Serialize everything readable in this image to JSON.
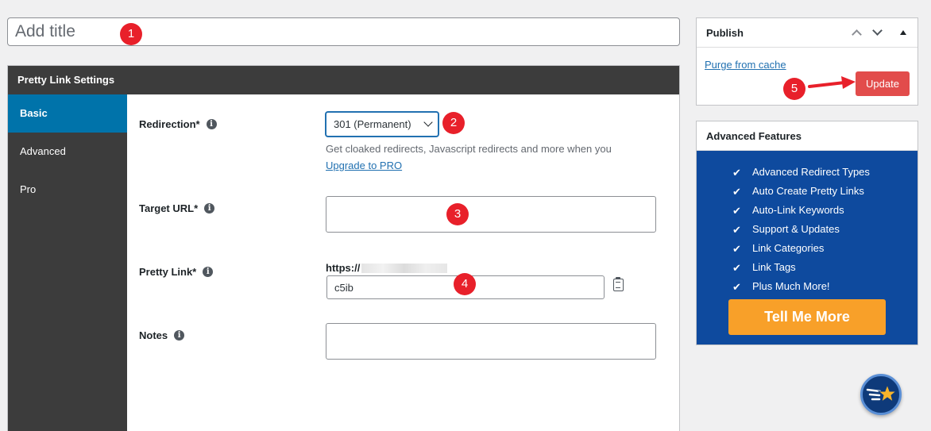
{
  "title_field": {
    "placeholder": "Add title",
    "value": ""
  },
  "callouts": [
    "1",
    "2",
    "3",
    "4",
    "5"
  ],
  "pretty_link_settings": {
    "heading": "Pretty Link Settings",
    "tabs": [
      {
        "label": "Basic",
        "active": true
      },
      {
        "label": "Advanced",
        "active": false
      },
      {
        "label": "Pro",
        "active": false
      }
    ],
    "redirection": {
      "label": "Redirection*",
      "selected": "301 (Permanent)",
      "help": "Get cloaked redirects, Javascript redirects and more when you",
      "upgrade_link": "Upgrade to PRO"
    },
    "target_url": {
      "label": "Target URL*",
      "value": ""
    },
    "pretty_link": {
      "label": "Pretty Link*",
      "prefix": "https://",
      "slug": "c5ib"
    },
    "notes": {
      "label": "Notes",
      "value": ""
    }
  },
  "publish": {
    "title": "Publish",
    "purge_link": "Purge from cache",
    "update_button": "Update"
  },
  "advanced_features": {
    "title": "Advanced Features",
    "items": [
      "Advanced Redirect Types",
      "Auto Create Pretty Links",
      "Auto-Link Keywords",
      "Support & Updates",
      "Link Categories",
      "Link Tags",
      "Plus Much More!"
    ],
    "cta": "Tell Me More"
  },
  "colors": {
    "header_dark": "#3c3c3c",
    "tab_active": "#0073aa",
    "callout_red": "#e8202a",
    "update_red": "#e24c4b",
    "features_blue": "#0e4a9e",
    "cta_orange": "#f8a029",
    "link_blue": "#2271b1"
  }
}
